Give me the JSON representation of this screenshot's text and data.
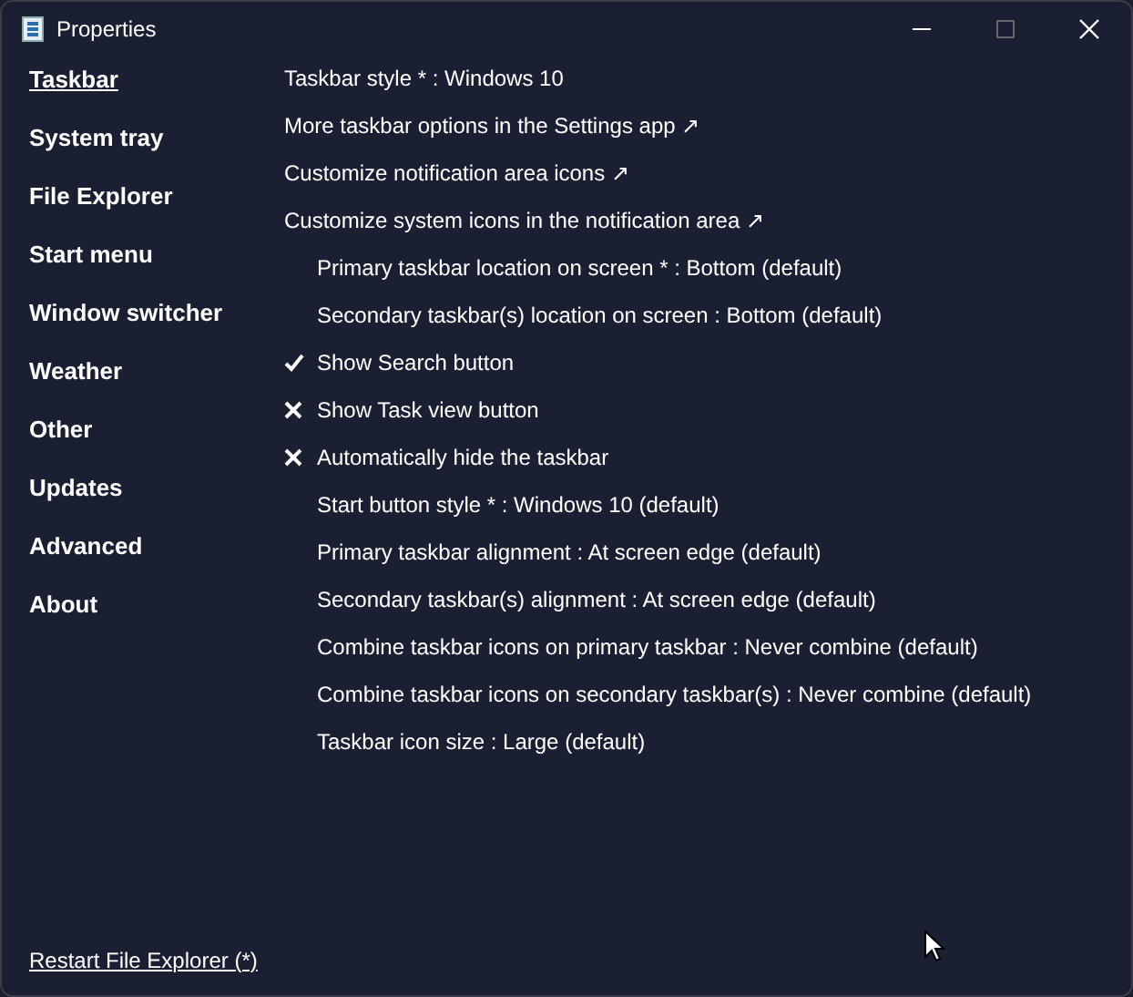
{
  "window": {
    "title": "Properties"
  },
  "sidebar": {
    "items": [
      {
        "label": "Taskbar",
        "selected": true
      },
      {
        "label": "System tray",
        "selected": false
      },
      {
        "label": "File Explorer",
        "selected": false
      },
      {
        "label": "Start menu",
        "selected": false
      },
      {
        "label": "Window switcher",
        "selected": false
      },
      {
        "label": "Weather",
        "selected": false
      },
      {
        "label": "Other",
        "selected": false
      },
      {
        "label": "Updates",
        "selected": false
      },
      {
        "label": "Advanced",
        "selected": false
      },
      {
        "label": "About",
        "selected": false
      }
    ]
  },
  "settings": [
    {
      "kind": "plain",
      "label": "Taskbar style * : Windows 10"
    },
    {
      "kind": "link",
      "label": "More taskbar options in the Settings app ↗"
    },
    {
      "kind": "link",
      "label": "Customize notification area icons ↗"
    },
    {
      "kind": "link",
      "label": "Customize system icons in the notification area ↗"
    },
    {
      "kind": "option",
      "label": "Primary taskbar location on screen * : Bottom (default)"
    },
    {
      "kind": "option",
      "label": "Secondary taskbar(s) location on screen : Bottom (default)"
    },
    {
      "kind": "toggle",
      "label": "Show Search button",
      "checked": true
    },
    {
      "kind": "toggle",
      "label": "Show Task view button",
      "checked": false
    },
    {
      "kind": "toggle",
      "label": "Automatically hide the taskbar",
      "checked": false
    },
    {
      "kind": "option",
      "label": "Start button style * : Windows 10 (default)"
    },
    {
      "kind": "option",
      "label": "Primary taskbar alignment : At screen edge (default)"
    },
    {
      "kind": "option",
      "label": "Secondary taskbar(s) alignment : At screen edge (default)"
    },
    {
      "kind": "option",
      "label": "Combine taskbar icons on primary taskbar : Never combine (default)"
    },
    {
      "kind": "option",
      "label": "Combine taskbar icons on secondary taskbar(s) : Never combine (default)"
    },
    {
      "kind": "option",
      "label": "Taskbar icon size : Large (default)"
    }
  ],
  "footer": {
    "link": "Restart File Explorer (*)"
  }
}
